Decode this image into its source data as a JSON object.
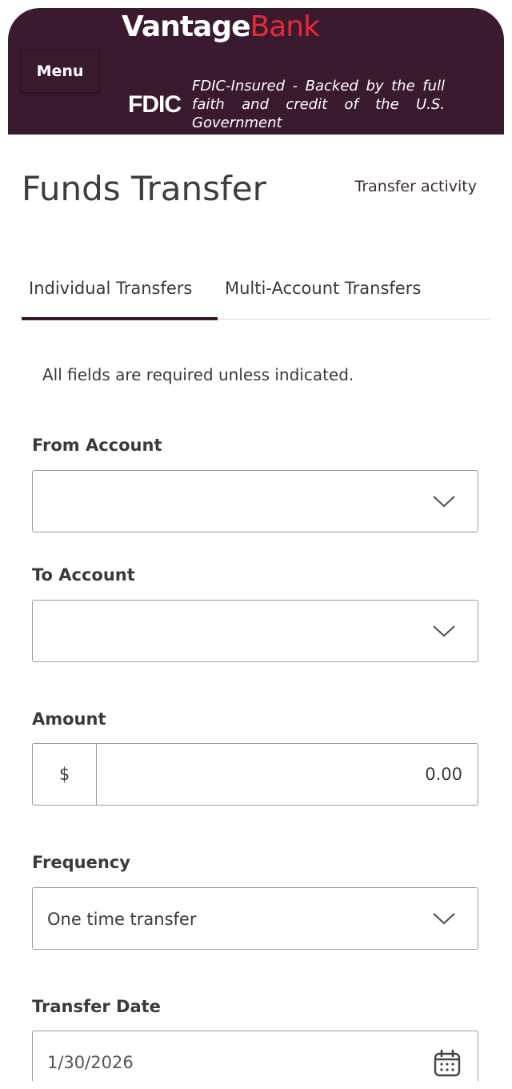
{
  "header": {
    "logo_vantage": "Vantage",
    "logo_bank": "Bank",
    "menu_label": "Menu",
    "fdic_logo": "FDIC",
    "fdic_text": "FDIC-Insured - Backed by the full faith and credit of the U.S. Government"
  },
  "page": {
    "title": "Funds Transfer",
    "activity_link": "Transfer activity"
  },
  "tabs": [
    {
      "label": "Individual Transfers",
      "active": true
    },
    {
      "label": "Multi-Account Transfers",
      "active": false
    }
  ],
  "form": {
    "helper_text": "All fields are required unless indicated.",
    "from_account": {
      "label": "From Account",
      "value": ""
    },
    "to_account": {
      "label": "To Account",
      "value": ""
    },
    "amount": {
      "label": "Amount",
      "currency": "$",
      "value": "0.00"
    },
    "frequency": {
      "label": "Frequency",
      "value": "One time transfer"
    },
    "transfer_date": {
      "label": "Transfer Date",
      "value": "1/30/2026"
    }
  },
  "colors": {
    "brand_dark": "#3a1a2e",
    "brand_red": "#e8293a"
  }
}
